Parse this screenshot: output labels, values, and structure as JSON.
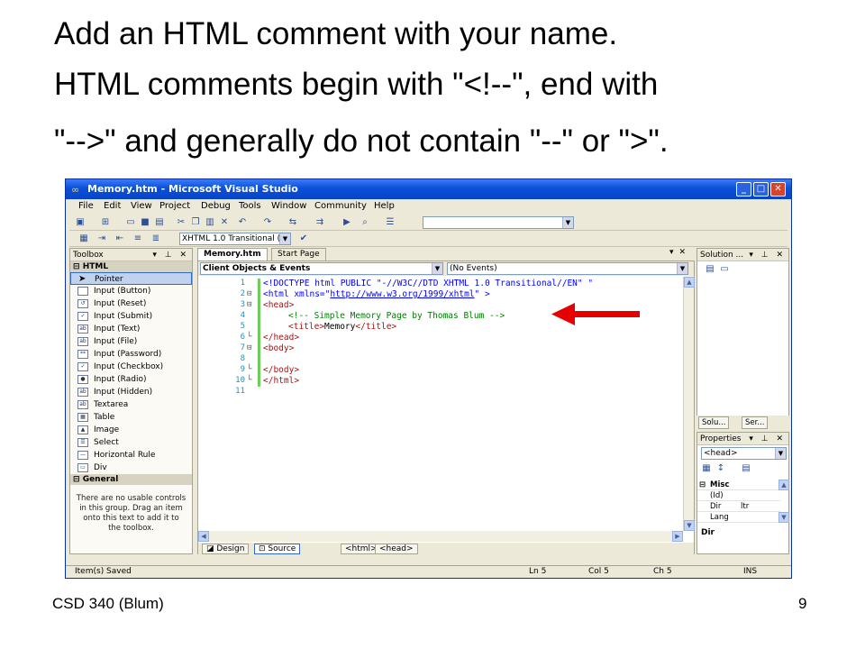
{
  "slide": {
    "title_lines": [
      "Add an HTML comment with your name.",
      "HTML comments begin with \"<!--\", end with",
      "\"-->\" and generally do not contain \"--\" or \">\"."
    ],
    "footer_left": "CSD 340 (Blum)",
    "page_number": "9"
  },
  "window": {
    "title": "Memory.htm - Microsoft Visual Studio",
    "controls": {
      "minimize": "_",
      "maximize": "□",
      "close": "✕"
    },
    "menu": [
      "File",
      "Edit",
      "View",
      "Project",
      "Debug",
      "Tools",
      "Window",
      "Community",
      "Help"
    ],
    "toolbar_combo": "XHTML 1.0 Transitional (",
    "toolbox": {
      "title": "Toolbox",
      "group_html": "HTML",
      "items": [
        "Pointer",
        "Input (Button)",
        "Input (Reset)",
        "Input (Submit)",
        "Input (Text)",
        "Input (File)",
        "Input (Password)",
        "Input (Checkbox)",
        "Input (Radio)",
        "Input (Hidden)",
        "Textarea",
        "Table",
        "Image",
        "Select",
        "Horizontal Rule",
        "Div"
      ],
      "group_general": "General",
      "empty_message": "There are no usable controls in this group. Drag an item onto this text to add it to the toolbox."
    },
    "tabs": [
      "Memory.htm",
      "Start Page"
    ],
    "nav_left": "Client Objects & Events",
    "nav_right": "(No Events)",
    "line_numbers": [
      "1",
      "2",
      "3",
      "4",
      "5",
      "6",
      "7",
      "8",
      "9",
      "10",
      "11"
    ],
    "code": {
      "l1": "<!DOCTYPE html PUBLIC \"-//W3C//DTD XHTML 1.0 Transitional//EN\" \"",
      "l2_a": "<html xmlns=\"",
      "l2_url": "http://www.w3.org/1999/xhtml",
      "l2_b": "\" >",
      "l3": "<head>",
      "l4": "<!-- Simple Memory Page by Thomas Blum -->",
      "l5_a": "<title>",
      "l5_b": "Memory",
      "l5_c": "</title>",
      "l6": "</head>",
      "l7": "<body>",
      "l9": "</body>",
      "l10": "</html>"
    },
    "view_buttons": [
      "Design",
      "Source"
    ],
    "tag_path": [
      "<html>",
      "<head>"
    ],
    "solution": {
      "title": "Solution ...",
      "tabs": [
        "Solu...",
        "Ser..."
      ]
    },
    "properties": {
      "title": "Properties",
      "selected": "<head>",
      "category": "Misc",
      "rows": [
        {
          "name": "(Id)",
          "value": ""
        },
        {
          "name": "Dir",
          "value": "ltr"
        },
        {
          "name": "Lang",
          "value": ""
        }
      ],
      "description": "Dir"
    },
    "status": {
      "message": "Item(s) Saved",
      "ln": "Ln 5",
      "col": "Col 5",
      "ch": "Ch 5",
      "mode": "INS"
    }
  },
  "colors": {
    "title_blue": "#0a4fd8",
    "arrow_red": "#e60000",
    "comment_green": "#008000",
    "tag_maroon": "#a31515"
  }
}
